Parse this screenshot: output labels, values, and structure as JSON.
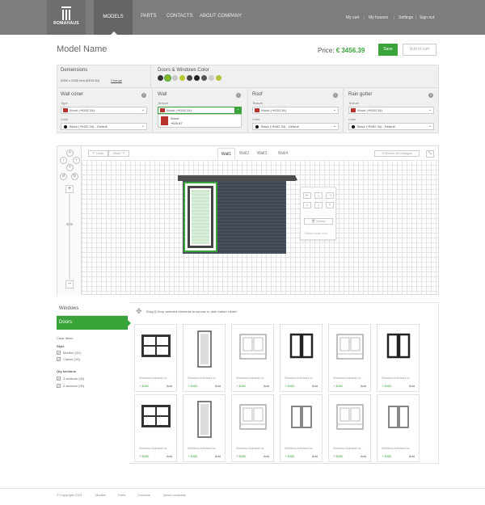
{
  "header": {
    "logo_text": "ROMAHAUS",
    "nav": [
      "MODELS",
      "PARTS",
      "CONTACTS",
      "ABOUT COMPANY"
    ],
    "right_links": [
      "My cart",
      "My houses",
      "Settings",
      "Sign out"
    ]
  },
  "title": {
    "model_name": "Model Name",
    "price_label": "Price:",
    "price_value": "€ 3456.39",
    "save": "Save",
    "add_to_cart": "Add to cart"
  },
  "dimensions": {
    "label": "Demensions",
    "value": "2000 x 2000 mm (€224.00)",
    "change": "Change"
  },
  "doors_windows_color": {
    "label": "Doors & Windows Color",
    "swatches": [
      "#333333",
      "#8ab82a",
      "#c6c6c6",
      "#b8c82e",
      "#444444",
      "#222222",
      "#555555",
      "#cccccc",
      "#b5c23a"
    ]
  },
  "panels": [
    {
      "title": "Wall coner",
      "type_label": "Type",
      "type_value": "Wood (+€452.34)",
      "color_label": "Color",
      "color_value": "Black (+€452.34) - Default"
    },
    {
      "title": "Wall",
      "texture_label": "Texture",
      "texture_value": "Wood (+€452.34)",
      "dropdown": [
        {
          "name": "Wood",
          "price": "+€45.67"
        }
      ]
    },
    {
      "title": "Roof",
      "texture_label": "Texture",
      "texture_value": "Wood (+€452.34)",
      "color_label": "Color",
      "color_value": "Black (+€452.34) - Default"
    },
    {
      "title": "Rain gutter",
      "texture_label": "Texture",
      "texture_value": "Wood (+€452.34)",
      "color_label": "Color",
      "color_value": "Black (+€452.34) - Default"
    }
  ],
  "toolbar": {
    "undo": "Undo",
    "redo": "Redo",
    "tabs": [
      "Wall1",
      "Wall2",
      "Wall3",
      "Wall4"
    ],
    "revert": "Revert all changes"
  },
  "popup": {
    "delete": "Delete",
    "more": "Show more info"
  },
  "sidebar": {
    "windows": "Windows",
    "doors": "Doors",
    "clear": "Clear filters",
    "style_label": "Style",
    "style_options": [
      "Modern (30)",
      "Classic (30)"
    ],
    "qty_label": "Qty sections",
    "qty_options": [
      "3 sections (30)",
      "2 sections (30)"
    ]
  },
  "catalog": {
    "hint": "Drag & Drop selected elements to canvas or click button «Add»",
    "item_name": "Window Antracet w...",
    "item_price": "+ $450",
    "add": "Add"
  },
  "footer": {
    "copyright": "© Copyright 2013",
    "links": [
      "Models",
      "Parts",
      "Contacts",
      "About company"
    ]
  },
  "colors": {
    "accent": "#3aa33a",
    "header": "#7d7e7b",
    "wall": "#4a5260"
  }
}
